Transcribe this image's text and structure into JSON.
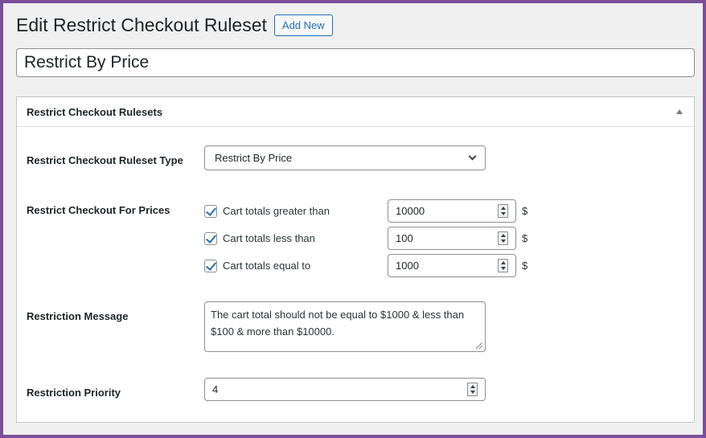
{
  "header": {
    "title": "Edit Restrict Checkout Ruleset",
    "add_new_label": "Add New"
  },
  "post_title": {
    "value": "Restrict By Price"
  },
  "panel": {
    "title": "Restrict Checkout Rulesets",
    "toggle_icon": "triangle-up-icon",
    "ruleset_type": {
      "label": "Restrict Checkout Ruleset Type",
      "selected": "Restrict By Price"
    },
    "prices": {
      "label": "Restrict Checkout For Prices",
      "conditions": [
        {
          "label": "Cart totals greater than",
          "checked": true,
          "value": "10000",
          "unit": "$"
        },
        {
          "label": "Cart totals less than",
          "checked": true,
          "value": "100",
          "unit": "$"
        },
        {
          "label": "Cart totals equal to",
          "checked": true,
          "value": "1000",
          "unit": "$"
        }
      ]
    },
    "message": {
      "label": "Restriction Message",
      "value": "The cart total should not be equal to $1000 & less than $100 & more than $10000."
    },
    "priority": {
      "label": "Restriction Priority",
      "value": "4"
    }
  },
  "colors": {
    "accent": "#2271b1",
    "frame": "#7a4f9a",
    "background": "#f0f0f1"
  }
}
